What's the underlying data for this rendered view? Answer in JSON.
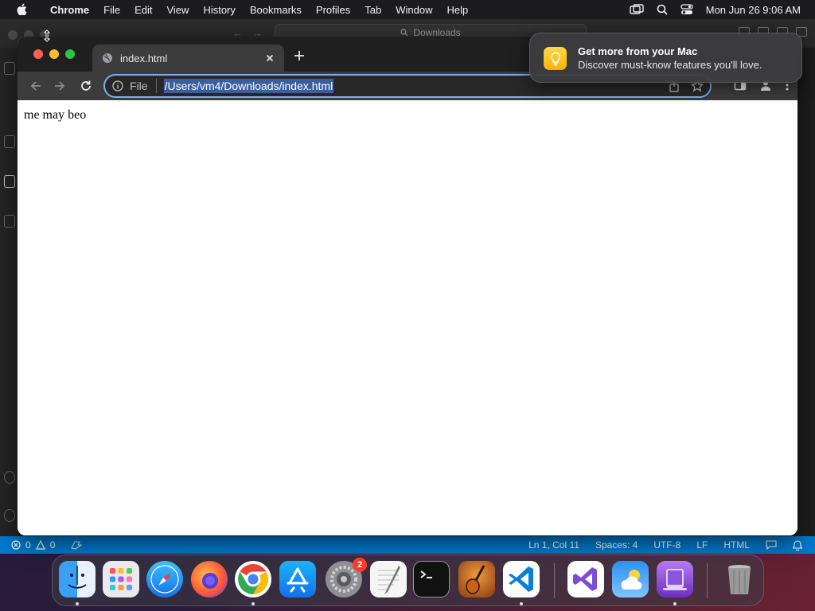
{
  "menubar": {
    "app_name": "Chrome",
    "items": [
      "File",
      "Edit",
      "View",
      "History",
      "Bookmarks",
      "Profiles",
      "Tab",
      "Window",
      "Help"
    ],
    "clock": "Mon Jun 26  9:06 AM"
  },
  "vscode": {
    "search_placeholder": "Downloads",
    "status": {
      "errors": "0",
      "warnings": "0",
      "position": "Ln 1, Col 11",
      "spaces": "Spaces: 4",
      "encoding": "UTF-8",
      "eol": "LF",
      "language": "HTML"
    },
    "colors": {
      "statusbar": "#007acc"
    }
  },
  "chrome": {
    "tab_title": "index.html",
    "scheme_label": "File",
    "url": "/Users/vm4/Downloads/index.html",
    "page_text": "me may beo",
    "colors": {
      "focus_ring": "#7cacf8",
      "url_selection": "#3b5f9c"
    }
  },
  "notification": {
    "title": "Get more from your Mac",
    "body": "Discover must-know features you'll love.",
    "icon": "lightbulb-icon"
  },
  "dock": {
    "apps": [
      {
        "name": "Finder",
        "icon": "finder-icon"
      },
      {
        "name": "Launchpad",
        "icon": "launchpad-icon"
      },
      {
        "name": "Safari",
        "icon": "safari-icon"
      },
      {
        "name": "Firefox",
        "icon": "firefox-icon"
      },
      {
        "name": "Google Chrome",
        "icon": "chrome-icon"
      },
      {
        "name": "App Store",
        "icon": "app-store-icon"
      },
      {
        "name": "System Settings",
        "icon": "system-settings-icon",
        "badge": "2"
      },
      {
        "name": "TextEdit",
        "icon": "textedit-icon"
      },
      {
        "name": "Terminal",
        "icon": "terminal-icon"
      },
      {
        "name": "GarageBand",
        "icon": "garageband-icon"
      },
      {
        "name": "Visual Studio Code",
        "icon": "vscode-icon"
      },
      {
        "name": "Visual Studio",
        "icon": "visual-studio-icon"
      },
      {
        "name": "Weather",
        "icon": "weather-icon"
      },
      {
        "name": "Simulator",
        "icon": "simulator-icon"
      },
      {
        "name": "Trash",
        "icon": "trash-icon"
      }
    ]
  }
}
